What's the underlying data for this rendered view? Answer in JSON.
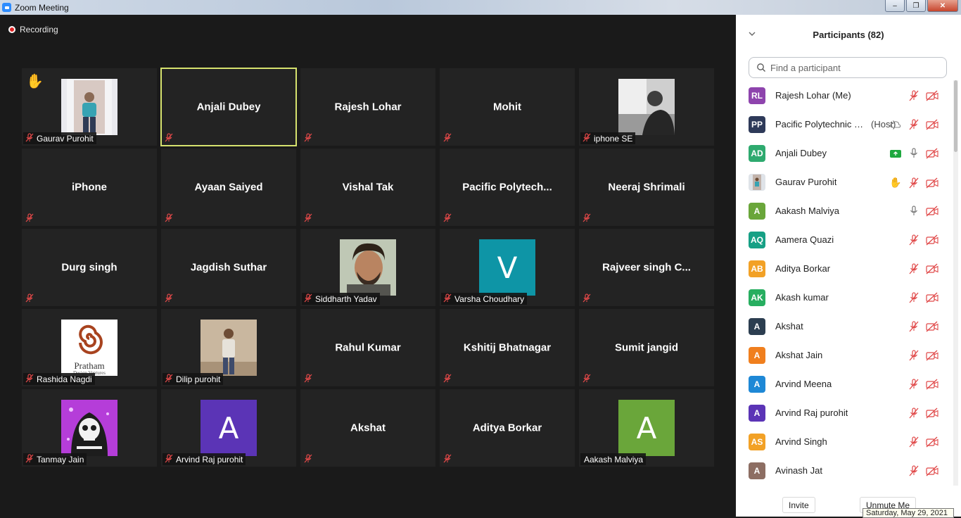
{
  "window": {
    "title": "Zoom Meeting",
    "min": "–",
    "max": "❐",
    "close": "✕"
  },
  "recording": {
    "label": "Recording"
  },
  "tiles": [
    {
      "name": "Gaurav Purohit",
      "kind": "photo",
      "photo": "phone-selfie",
      "hand": "✋",
      "label": "Gaurav Purohit"
    },
    {
      "name": "Anjali Dubey",
      "kind": "name",
      "speaking": true
    },
    {
      "name": "Rajesh Lohar",
      "kind": "name"
    },
    {
      "name": "Mohit",
      "kind": "name"
    },
    {
      "name": "iphone SE",
      "kind": "photo",
      "photo": "bw-portrait",
      "label": "iphone SE"
    },
    {
      "name": "iPhone",
      "kind": "name"
    },
    {
      "name": "Ayaan Saiyed",
      "kind": "name"
    },
    {
      "name": "Vishal Tak",
      "kind": "name"
    },
    {
      "name": "Pacific  Polytech...",
      "kind": "name"
    },
    {
      "name": "Neeraj Shrimali",
      "kind": "name"
    },
    {
      "name": "Durg singh",
      "kind": "name"
    },
    {
      "name": "Jagdish Suthar",
      "kind": "name"
    },
    {
      "name": "Siddharth Yadav",
      "kind": "photo",
      "photo": "face-portrait",
      "label": "Siddharth Yadav"
    },
    {
      "name": "Varsha Choudhary",
      "kind": "letter",
      "letter": "V",
      "color": "#0e95a6",
      "label": "Varsha Choudhary"
    },
    {
      "name": "Rajveer singh  C...",
      "kind": "name"
    },
    {
      "name": "Rashida Nagdi",
      "kind": "logo",
      "logo_text": "Pratham",
      "logo_sub": "Design Ventures",
      "label": "Rashida Nagdi"
    },
    {
      "name": "Dilip purohit",
      "kind": "photo",
      "photo": "standing-man",
      "label": "Dilip purohit"
    },
    {
      "name": "Rahul Kumar",
      "kind": "name"
    },
    {
      "name": "Kshitij Bhatnagar",
      "kind": "name"
    },
    {
      "name": "Sumit jangid",
      "kind": "name"
    },
    {
      "name": "Tanmay Jain",
      "kind": "photo",
      "photo": "skull-cartoon",
      "label": "Tanmay Jain"
    },
    {
      "name": "Arvind Raj purohit",
      "kind": "letter",
      "letter": "A",
      "color": "#5b34b6",
      "label": "Arvind Raj purohit"
    },
    {
      "name": "Akshat",
      "kind": "name"
    },
    {
      "name": "Aditya Borkar",
      "kind": "name"
    },
    {
      "name": "Aakash Malviya",
      "kind": "letter",
      "letter": "A",
      "color": "#6aa63a",
      "label": "Aakash Malviya",
      "unmuted": true
    }
  ],
  "panel": {
    "title": "Participants (82)",
    "search_placeholder": "Find a participant",
    "participants": [
      {
        "initials": "RL",
        "name": "Rajesh Lohar (Me)",
        "color": "#8e44ad",
        "mic": "muted",
        "video": "off"
      },
      {
        "initials": "PP",
        "name": "Pacific Polytechnic C...",
        "role": "(Host)",
        "color": "#2e3a59",
        "mic": "muted",
        "video": "off",
        "cloud": true
      },
      {
        "initials": "AD",
        "name": "Anjali Dubey",
        "color": "#2eaa6f",
        "mic": "on",
        "video": "off",
        "share": true
      },
      {
        "initials": "",
        "name": "Gaurav Purohit",
        "color": "#9aa3ad",
        "mic": "muted",
        "video": "off",
        "hand": "✋"
      },
      {
        "initials": "A",
        "name": "Aakash Malviya",
        "color": "#6aa63a",
        "mic": "on",
        "video": "off"
      },
      {
        "initials": "AQ",
        "name": "Aamera Quazi",
        "color": "#16a085",
        "mic": "muted",
        "video": "off"
      },
      {
        "initials": "AB",
        "name": "Aditya Borkar",
        "color": "#f2a126",
        "mic": "muted",
        "video": "off"
      },
      {
        "initials": "AK",
        "name": "Akash kumar",
        "color": "#27ae60",
        "mic": "muted",
        "video": "off"
      },
      {
        "initials": "A",
        "name": "Akshat",
        "color": "#2c3e50",
        "mic": "muted",
        "video": "off"
      },
      {
        "initials": "A",
        "name": "Akshat Jain",
        "color": "#f07f1e",
        "mic": "muted",
        "video": "off"
      },
      {
        "initials": "A",
        "name": "Arvind Meena",
        "color": "#1e88d6",
        "mic": "muted",
        "video": "off"
      },
      {
        "initials": "A",
        "name": "Arvind Raj purohit",
        "color": "#5b34b6",
        "mic": "muted",
        "video": "off"
      },
      {
        "initials": "AS",
        "name": "Arvind Singh",
        "color": "#f2a126",
        "mic": "muted",
        "video": "off"
      },
      {
        "initials": "A",
        "name": "Avinash Jat",
        "color": "#8d6e63",
        "mic": "muted",
        "video": "off"
      }
    ],
    "invite_label": "Invite",
    "unmute_label": "Unmute Me"
  },
  "tooltip": {
    "date": "Saturday, May 29, 2021"
  }
}
